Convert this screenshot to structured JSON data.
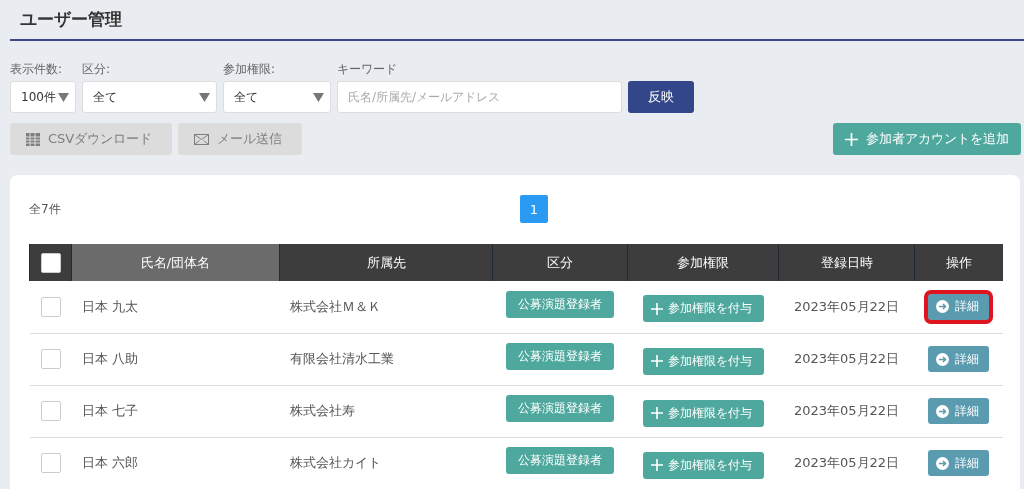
{
  "title": "ユーザー管理",
  "filters": [
    {
      "kind": "select",
      "label": "表示件数:",
      "value": "100件"
    },
    {
      "kind": "select",
      "label": "区分:",
      "value": "全て"
    },
    {
      "kind": "select",
      "label": "参加権限:",
      "value": "全て"
    },
    {
      "kind": "input",
      "label": "キーワード",
      "placeholder": "氏名/所属先/メールアドレス"
    }
  ],
  "apply_button": "反映",
  "actions": [
    {
      "kind": "csv",
      "label": "CSVダウンロード",
      "disabled": true
    },
    {
      "kind": "mail",
      "label": "メール送信",
      "disabled": true
    }
  ],
  "add_button": "参加者アカウントを追加",
  "total": "全7件",
  "pages": [
    {
      "label": "1",
      "selected": true
    }
  ],
  "table": {
    "select_all_checked": false,
    "columns": [
      {
        "label": "氏名/団体名",
        "sorted": true
      },
      {
        "label": "所属先",
        "sorted": false
      },
      {
        "label": "区分",
        "sorted": false
      },
      {
        "label": "参加権限",
        "sorted": false
      },
      {
        "label": "登録日時",
        "sorted": false
      },
      {
        "label": "操作",
        "sorted": false
      }
    ],
    "rows": [
      {
        "checked": false,
        "name": "日本 九太",
        "affiliation": "株式会社Ｍ＆Ｋ",
        "category": "公募演題登録者",
        "grant": "参加権限を付与",
        "date": "2023年05月22日",
        "detail": "詳細",
        "highlighted": true
      },
      {
        "checked": false,
        "name": "日本 八助",
        "affiliation": "有限会社清水工業",
        "category": "公募演題登録者",
        "grant": "参加権限を付与",
        "date": "2023年05月22日",
        "detail": "詳細",
        "highlighted": false
      },
      {
        "checked": false,
        "name": "日本 七子",
        "affiliation": "株式会社寿",
        "category": "公募演題登録者",
        "grant": "参加権限を付与",
        "date": "2023年05月22日",
        "detail": "詳細",
        "highlighted": false
      },
      {
        "checked": false,
        "name": "日本 六郎",
        "affiliation": "株式会社カイト",
        "category": "公募演題登録者",
        "grant": "参加権限を付与",
        "date": "2023年05月22日",
        "detail": "詳細",
        "highlighted": false
      }
    ]
  }
}
